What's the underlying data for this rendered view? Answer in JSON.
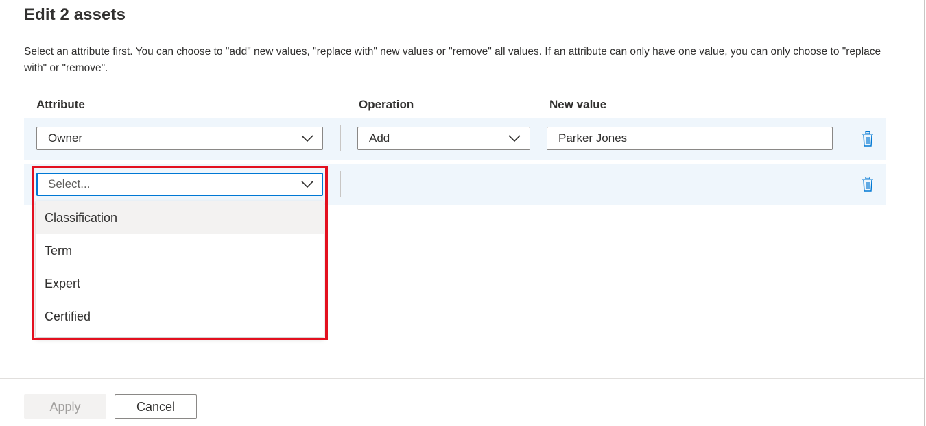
{
  "dialog": {
    "title": "Edit 2 assets",
    "description": "Select an attribute first. You can choose to \"add\" new values, \"replace with\" new values or \"remove\" all values. If an attribute can only have one value, you can only choose to \"replace with\" or \"remove\"."
  },
  "columns": {
    "attribute": "Attribute",
    "operation": "Operation",
    "new_value": "New value"
  },
  "rows": [
    {
      "attribute": "Owner",
      "operation": "Add",
      "new_value": "Parker Jones"
    },
    {
      "attribute_placeholder": "Select...",
      "menu_options": [
        "Classification",
        "Term",
        "Expert",
        "Certified"
      ],
      "hovered_option": "Classification"
    }
  ],
  "footer": {
    "apply_label": "Apply",
    "cancel_label": "Cancel",
    "apply_disabled": true
  },
  "icons": {
    "chevron": "chevron-down-icon",
    "delete": "trash-icon"
  },
  "colors": {
    "accent": "#0078d4",
    "row_background": "#eff6fc",
    "highlight": "#e3101f",
    "menu_hover": "#f3f2f1"
  }
}
